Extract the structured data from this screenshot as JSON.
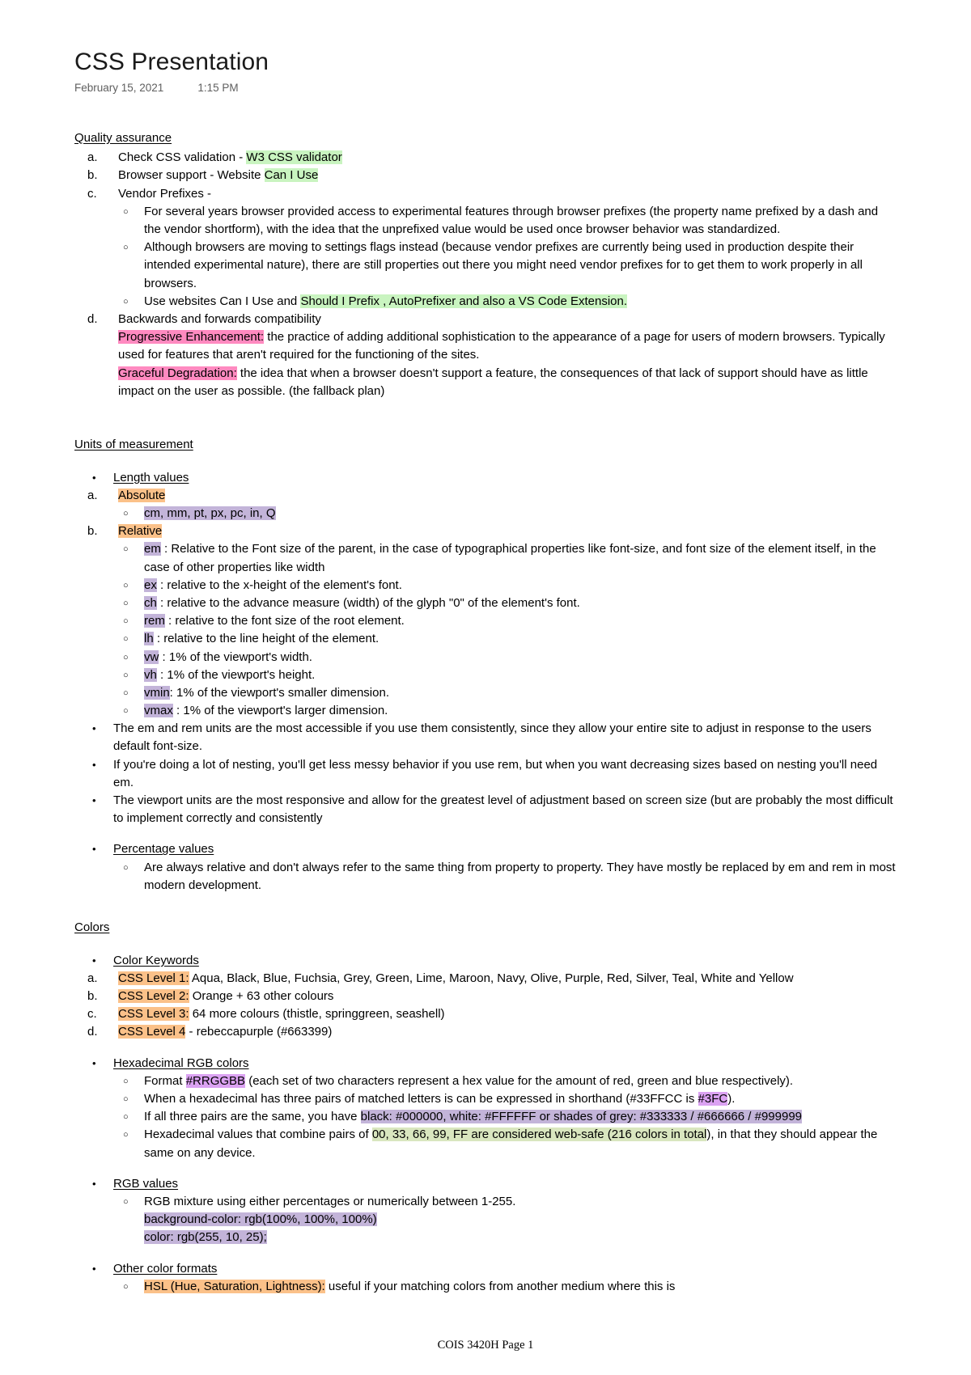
{
  "document": {
    "title": "CSS Presentation",
    "date": "February 15, 2021",
    "time": "1:15 PM",
    "footer": "COIS 3420H Page 1"
  },
  "markers": {
    "a": "a.",
    "b": "b.",
    "c": "c.",
    "d": "d.",
    "bullet": "•",
    "circle": "○"
  },
  "sections": {
    "quality_assurance": {
      "heading": "Quality assurance",
      "item_a_pre": "Check CSS validation - ",
      "item_a_hl": "W3 CSS validator",
      "item_b_pre": "Browser support - Website ",
      "item_b_hl": "Can I Use",
      "item_c": "Vendor Prefixes -",
      "item_c_sub1": "For several years browser provided access to experimental features through browser prefixes (the property name prefixed by a dash and the vendor shortform), with the idea that the unprefixed value would be used once browser behavior was standardized.",
      "item_c_sub2": "Although browsers are moving to settings flags instead (because vendor prefixes are currently being used in production despite their intended experimental nature), there are still properties out there you might need vendor prefixes for to get them to work properly in all browsers.",
      "item_c_sub3_pre": "Use websites Can I Use and ",
      "item_c_sub3_hl": "Should I Prefix , AutoPrefixer and also a VS Code Extension.",
      "item_d": "Backwards and forwards compatibility",
      "progressive_label": "Progressive Enhancement:",
      "progressive_text": " the practice of adding additional sophistication to the appearance of a page for users of modern browsers. Typically used for features that aren't required for the functioning of the sites.",
      "graceful_label": "Graceful Degradation:",
      "graceful_text": " the idea that when a browser doesn't support a feature, the consequences of that lack of support should have as little impact on the user as possible. (the fallback plan)"
    },
    "units": {
      "heading": "Units of measurement",
      "length_values": "Length values",
      "absolute_label": "Absolute",
      "absolute_units": "cm, mm, pt, px, pc, in, Q",
      "relative_label": "Relative",
      "relative_units": [
        {
          "name": "em",
          "desc": " : Relative to the Font size of the parent, in the case of typographical properties like font-size, and font size of the element itself, in the case of other properties like width"
        },
        {
          "name": "ex",
          "desc": " : relative to the x-height of the element's font."
        },
        {
          "name": "ch",
          "desc": " : relative to the advance measure (width) of the glyph \"0\" of the element's font."
        },
        {
          "name": "rem",
          "desc": " : relative to the font size of the root element."
        },
        {
          "name": "lh",
          "desc": " : relative to the line height of the element."
        },
        {
          "name": "vw",
          "desc": " : 1% of the viewport's width."
        },
        {
          "name": "vh",
          "desc": " : 1% of the viewport's height."
        },
        {
          "name": "vmin",
          "desc": ": 1% of the viewport's smaller dimension."
        },
        {
          "name": "vmax",
          "desc": " : 1% of the viewport's larger dimension."
        }
      ],
      "note1": "The em and rem units are the most accessible if you use them consistently, since they allow your entire site to adjust in response to the users default font-size.",
      "note2": " If you're doing a lot of nesting, you'll get less messy behavior if you use rem, but when you want decreasing sizes based on nesting you'll need em.",
      "note3": "The viewport units are the most responsive and allow for the greatest level of adjustment based on screen size (but are probably the most difficult to implement correctly and consistently",
      "percentage_heading": "Percentage values",
      "percentage_text": "Are always relative and don't always refer to the same thing from property to property. They have mostly be replaced by em and rem in most modern development."
    },
    "colors": {
      "heading": "Colors",
      "keywords_heading": "Color Keywords",
      "levels": [
        {
          "label": "CSS Level 1:",
          "text": " Aqua, Black, Blue, Fuchsia, Grey, Green, Lime, Maroon, Navy, Olive, Purple, Red, Silver, Teal, White and Yellow"
        },
        {
          "label": "CSS Level 2:",
          "text": " Orange + 63 other colours"
        },
        {
          "label": "CSS Level 3:",
          "text": " 64 more colours (thistle, springgreen, seashell)"
        },
        {
          "label": "CSS Level 4",
          "text": " - rebeccapurple (#663399)"
        }
      ],
      "hex_heading": "Hexadecimal RGB colors",
      "hex_format_pre": "Format ",
      "hex_format_hl": "#RRGGBB",
      "hex_format_post": " (each set of two characters represent a hex value for the amount of red, green and blue respectively).",
      "hex_shorthand_pre": "When a hexadecimal has three pairs of matched letters is can be expressed in shorthand (#33FFCC is ",
      "hex_shorthand_hl": "#3FC",
      "hex_shorthand_post": ").",
      "hex_grey_pre": "If all three pairs are the same, you have ",
      "hex_grey_hl": "black: #000000, white: #FFFFFF or shades of grey: #333333 / #666666 / #999999",
      "hex_websafe_pre": "Hexadecimal values that combine pairs of ",
      "hex_websafe_hl": "00, 33, 66, 99, FF are considered web-safe (216 colors in total",
      "hex_websafe_post": "), in that they should appear the same on any device.",
      "rgb_heading": "RGB values",
      "rgb_text": "RGB mixture using either percentages or numerically between 1-255.",
      "rgb_code_line1": "background-color: rgb(100%, 100%, 100%)",
      "rgb_code_line2": "color: rgb(255, 10, 25);",
      "other_heading": "Other color formats",
      "hsl_label": "HSL (Hue, Saturation, Lightness):",
      "hsl_text": "  useful if your matching colors from another medium where this is"
    }
  }
}
